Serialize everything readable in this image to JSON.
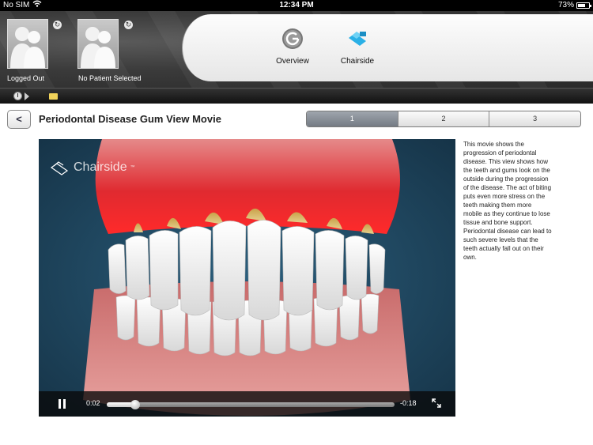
{
  "status_bar": {
    "carrier": "No SIM",
    "time": "12:34 PM",
    "battery_percent": "73%",
    "battery_level": 0.73
  },
  "header": {
    "user_label": "Logged Out",
    "patient_label": "No Patient Selected",
    "nav": [
      {
        "label": "Overview",
        "icon": "overview-power-icon"
      },
      {
        "label": "Chairside",
        "icon": "chairside-logo-icon"
      }
    ]
  },
  "page": {
    "back_label": "<",
    "title": "Periodontal Disease Gum View Movie",
    "segments": [
      "1",
      "2",
      "3"
    ],
    "active_segment": "1"
  },
  "video": {
    "watermark": "Chairside",
    "trademark": "™",
    "current_time": "0:02",
    "remaining_time": "-0:18",
    "progress": 0.1
  },
  "description": "This movie shows the progression of periodontal disease. This view shows how the teeth and gums look on the outside during the progression of the disease. The act of biting puts even more stress on the teeth making them more mobile as they continue to lose tissue and bone support. Periodontal disease can lead to such severe levels that the teeth actually fall out on their own."
}
